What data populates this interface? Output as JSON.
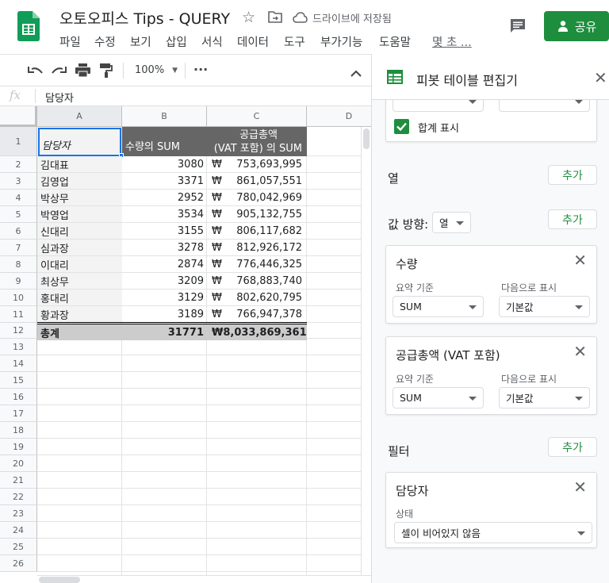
{
  "header": {
    "title": "오토오피스 Tips - QUERY",
    "drive_status": "드라이브에 저장됨",
    "share_label": "공유",
    "menu": [
      "파일",
      "수정",
      "보기",
      "삽입",
      "서식",
      "데이터",
      "도구",
      "부가기능",
      "도움말",
      "몇 초 ..."
    ]
  },
  "toolbar": {
    "zoom": "100%",
    "more": "···"
  },
  "formula_bar": {
    "fx": "fx",
    "value": "담당자"
  },
  "grid": {
    "columns": [
      "A",
      "B",
      "C",
      "D"
    ],
    "row_numbers": [
      "1",
      "2",
      "3",
      "4",
      "5",
      "6",
      "7",
      "8",
      "9",
      "10",
      "11",
      "12",
      "13",
      "14",
      "15",
      "16",
      "17",
      "18",
      "19",
      "20",
      "21",
      "22",
      "23",
      "24",
      "25",
      "26"
    ],
    "header_row": {
      "a": "담당자",
      "b": "수량의 SUM",
      "c1": "공급총액",
      "c2": "(VAT 포함) 의 SUM"
    },
    "currency": "₩",
    "rows": [
      {
        "name": "김대표",
        "qty": "3080",
        "amt": "753,693,995"
      },
      {
        "name": "김영업",
        "qty": "3371",
        "amt": "861,057,551"
      },
      {
        "name": "박상무",
        "qty": "2952",
        "amt": "780,042,969"
      },
      {
        "name": "박영업",
        "qty": "3534",
        "amt": "905,132,755"
      },
      {
        "name": "신대리",
        "qty": "3155",
        "amt": "806,117,682"
      },
      {
        "name": "심과장",
        "qty": "3278",
        "amt": "812,926,172"
      },
      {
        "name": "이대리",
        "qty": "2874",
        "amt": "776,446,325"
      },
      {
        "name": "최상무",
        "qty": "3209",
        "amt": "768,883,740"
      },
      {
        "name": "홍대리",
        "qty": "3129",
        "amt": "802,620,795"
      },
      {
        "name": "황과장",
        "qty": "3189",
        "amt": "766,947,378"
      }
    ],
    "total": {
      "name": "총계",
      "qty": "31771",
      "amt": "8,033,869,361"
    }
  },
  "panel": {
    "title": "피봇 테이블 편집기",
    "show_total": "합계 표시",
    "columns_label": "열",
    "add": "추가",
    "values_dir_label": "값 방향:",
    "values_dir_value": "열",
    "values": [
      {
        "title": "수량",
        "summarize_label": "요약 기준",
        "summarize_value": "SUM",
        "show_as_label": "다음으로 표시",
        "show_as_value": "기본값"
      },
      {
        "title": "공급총액 (VAT 포함)",
        "summarize_label": "요약 기준",
        "summarize_value": "SUM",
        "show_as_label": "다음으로 표시",
        "show_as_value": "기본값"
      }
    ],
    "filter_label": "필터",
    "filter": {
      "title": "담당자",
      "status_label": "상태",
      "status_value": "셀이 비어있지 않음"
    }
  },
  "colors": {
    "accent": "#1e8e3e",
    "header_dark": "#666666",
    "total_bg": "#cccccc",
    "name_bg": "#f3f3f3",
    "selection": "#1a73e8"
  }
}
